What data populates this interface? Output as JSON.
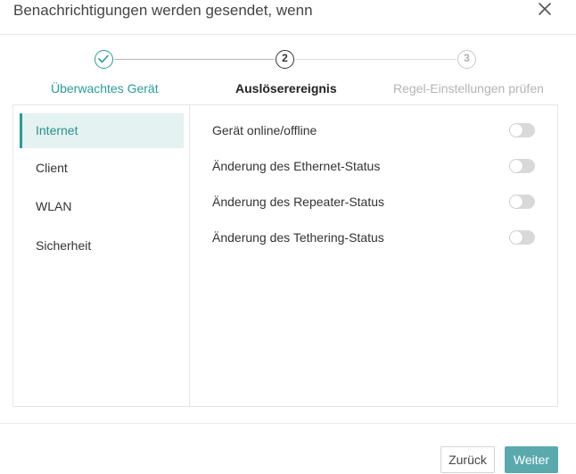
{
  "dialog": {
    "title": "Benachrichtigungen werden gesendet, wenn",
    "close_icon": "close-icon"
  },
  "stepper": {
    "steps": [
      {
        "number": "1",
        "label": "Überwachtes Gerät",
        "state": "completed",
        "icon": "check-icon"
      },
      {
        "number": "2",
        "label": "Auslöserereignis",
        "state": "current"
      },
      {
        "number": "3",
        "label": "Regel-Einstellungen prüfen",
        "state": "pending"
      }
    ]
  },
  "sidebar": {
    "items": [
      {
        "label": "Internet",
        "active": true
      },
      {
        "label": "Client",
        "active": false
      },
      {
        "label": "WLAN",
        "active": false
      },
      {
        "label": "Sicherheit",
        "active": false
      }
    ]
  },
  "events": [
    {
      "label": "Gerät online/offline",
      "enabled": false
    },
    {
      "label": "Änderung des Ethernet-Status",
      "enabled": false
    },
    {
      "label": "Änderung des Repeater-Status",
      "enabled": false
    },
    {
      "label": "Änderung des Tethering-Status",
      "enabled": false
    }
  ],
  "footer": {
    "back_label": "Zurück",
    "next_label": "Weiter"
  },
  "colors": {
    "accent": "#2a9d9a",
    "primary_button": "#5aa9ad",
    "toggle_off": "#d9d9d9"
  }
}
